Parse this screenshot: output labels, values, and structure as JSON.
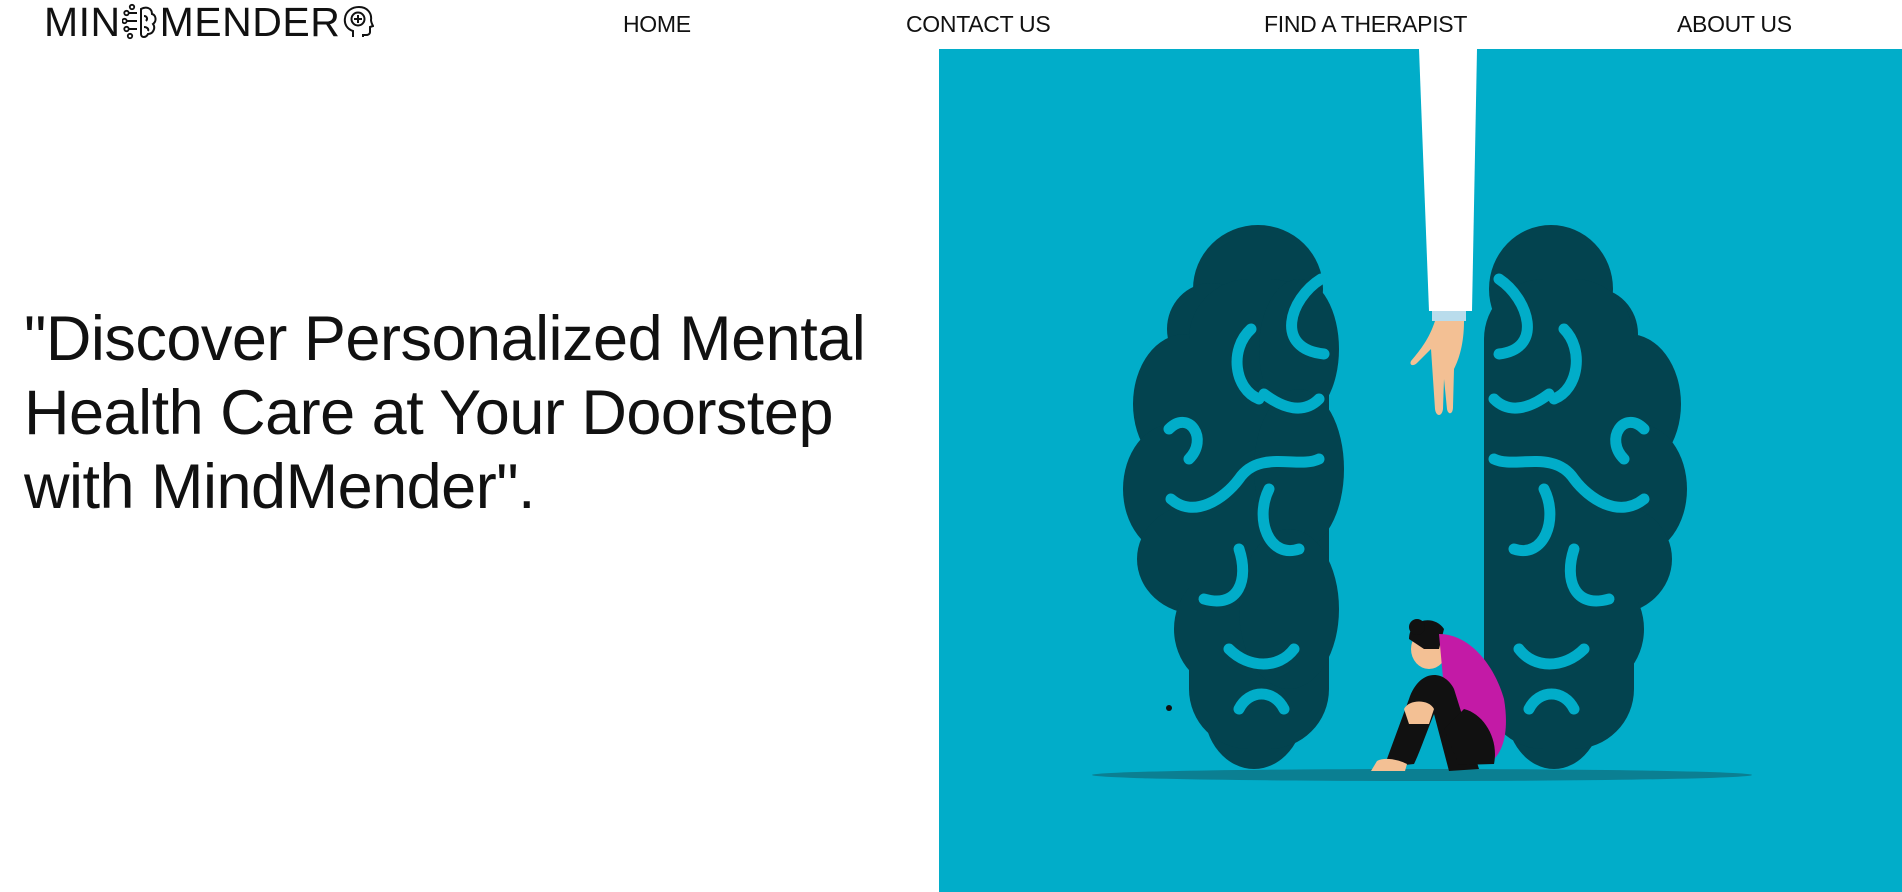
{
  "header": {
    "logo": {
      "part1": "MIN",
      "part2": "MENDER",
      "brain_icon": "brain-circuit-icon",
      "head_icon": "head-plus-icon"
    },
    "nav": [
      {
        "label": "HOME"
      },
      {
        "label": "CONTACT US"
      },
      {
        "label": "FIND A THERAPIST"
      },
      {
        "label": "ABOUT US"
      }
    ]
  },
  "hero": {
    "headline": "\"Discover Personalized Mental Health Care at Your Doorstep with MindMender\".",
    "illustration": {
      "background_color": "#01adc9",
      "brain_color": "#03434f",
      "sleeve_color": "#ffffff",
      "shirt_color": "#c31aa6"
    }
  }
}
